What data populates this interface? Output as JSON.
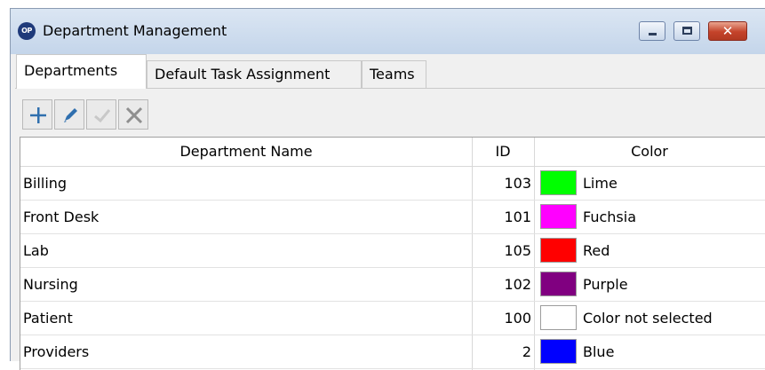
{
  "window": {
    "title": "Department Management",
    "app_icon_text": "OP",
    "controls": {
      "minimize_icon": "minimize-icon",
      "maximize_icon": "maximize-icon",
      "close_icon": "close-icon",
      "close_glyph": "✕"
    }
  },
  "tabs": [
    {
      "label": "Departments",
      "active": true
    },
    {
      "label": "Default Task Assignment",
      "active": false
    },
    {
      "label": "Teams",
      "active": false
    }
  ],
  "toolbar": {
    "buttons": [
      {
        "name": "add",
        "icon": "plus-icon",
        "enabled": true,
        "color": "#2f6fae"
      },
      {
        "name": "edit",
        "icon": "pencil-icon",
        "enabled": true,
        "color": "#2f6fae"
      },
      {
        "name": "save",
        "icon": "check-icon",
        "enabled": false,
        "color": "#c8c8c8"
      },
      {
        "name": "cancel",
        "icon": "x-icon",
        "enabled": false,
        "color": "#8f8f8f"
      }
    ]
  },
  "table": {
    "columns": [
      "Department Name",
      "ID",
      "Color"
    ],
    "rows": [
      {
        "name": "Billing",
        "id": "103",
        "color_hex": "#00ff00",
        "color_name": "Lime"
      },
      {
        "name": "Front Desk",
        "id": "101",
        "color_hex": "#ff00ff",
        "color_name": "Fuchsia"
      },
      {
        "name": "Lab",
        "id": "105",
        "color_hex": "#ff0000",
        "color_name": "Red"
      },
      {
        "name": "Nursing",
        "id": "102",
        "color_hex": "#800080",
        "color_name": "Purple"
      },
      {
        "name": "Patient",
        "id": "100",
        "color_hex": "#ffffff",
        "color_name": "Color not selected"
      },
      {
        "name": "Providers",
        "id": "2",
        "color_hex": "#0000ff",
        "color_name": "Blue"
      }
    ]
  }
}
